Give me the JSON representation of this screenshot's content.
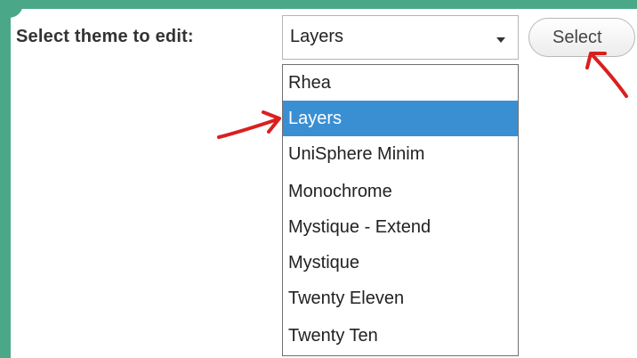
{
  "form": {
    "label": "Select theme to edit:",
    "selected_value": "Layers",
    "button_label": "Select"
  },
  "dropdown": {
    "options": [
      "Rhea",
      "Layers",
      "UniSphere Minim",
      "Monochrome",
      "Mystique - Extend",
      "Mystique",
      "Twenty Eleven",
      "Twenty Ten"
    ],
    "highlighted": "Layers"
  },
  "colors": {
    "frame": "#4aa889",
    "highlight": "#3a8fd3",
    "annotation_arrow": "#d9201f"
  }
}
